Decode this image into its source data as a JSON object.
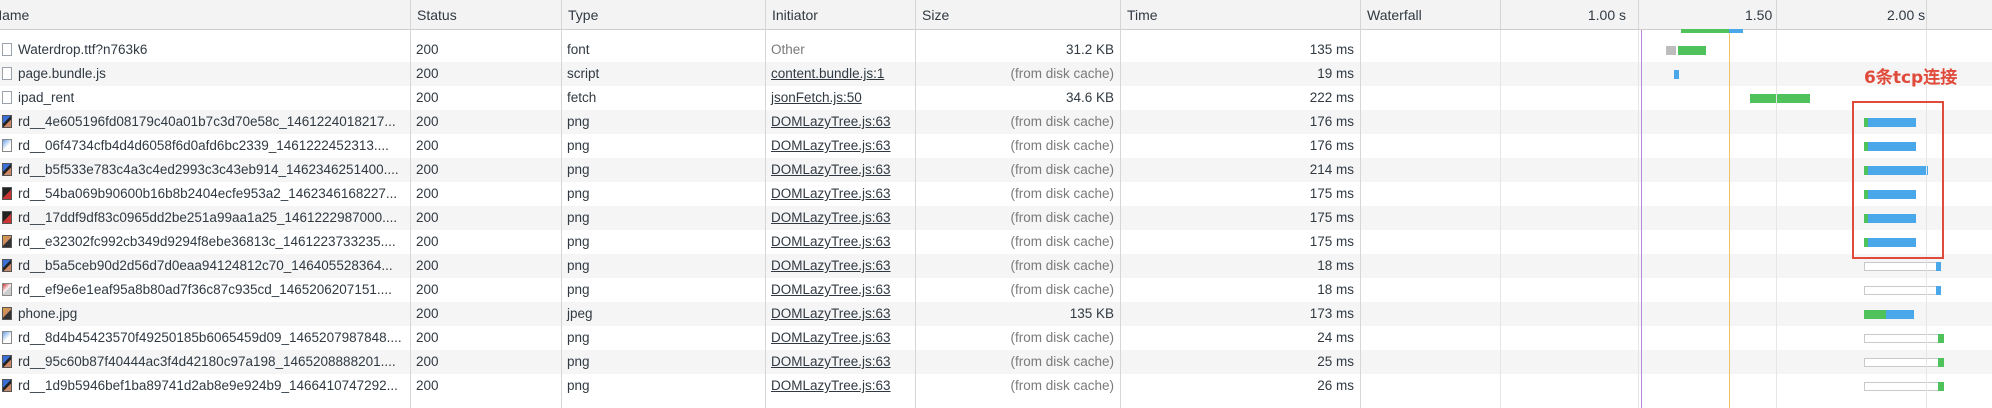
{
  "header": {
    "name": "Name",
    "status": "Status",
    "type": "Type",
    "initiator": "Initiator",
    "size": "Size",
    "time": "Time",
    "waterfall": "Waterfall",
    "ticks": [
      "1.00 s",
      "1.50 s",
      "2.00 s"
    ]
  },
  "rows": [
    {
      "name": "Waterdrop.ttf?n763k6",
      "status": "200",
      "type": "font",
      "initiator": "Other",
      "size": "31.2 KB",
      "time": "135 ms"
    },
    {
      "name": "page.bundle.js",
      "status": "200",
      "type": "script",
      "initiator": "content.bundle.js:1",
      "size": "(from disk cache)",
      "time": "19 ms"
    },
    {
      "name": "ipad_rent",
      "status": "200",
      "type": "fetch",
      "initiator": "jsonFetch.js:50",
      "size": "34.6 KB",
      "time": "222 ms"
    },
    {
      "name": "rd__4e605196fd08179c40a01b7c3d70e58c_1461224018217...",
      "status": "200",
      "type": "png",
      "initiator": "DOMLazyTree.js:63",
      "size": "(from disk cache)",
      "time": "176 ms"
    },
    {
      "name": "rd__06f4734cfb4d4d6058f6d0afd6bc2339_1461222452313....",
      "status": "200",
      "type": "png",
      "initiator": "DOMLazyTree.js:63",
      "size": "(from disk cache)",
      "time": "176 ms"
    },
    {
      "name": "rd__b5f533e783c4a3c4ed2993c3c43eb914_1462346251400....",
      "status": "200",
      "type": "png",
      "initiator": "DOMLazyTree.js:63",
      "size": "(from disk cache)",
      "time": "214 ms"
    },
    {
      "name": "rd__54ba069b90600b16b8b2404ecfe953a2_1462346168227...",
      "status": "200",
      "type": "png",
      "initiator": "DOMLazyTree.js:63",
      "size": "(from disk cache)",
      "time": "175 ms"
    },
    {
      "name": "rd__17ddf9df83c0965dd2be251a99aa1a25_1461222987000....",
      "status": "200",
      "type": "png",
      "initiator": "DOMLazyTree.js:63",
      "size": "(from disk cache)",
      "time": "175 ms"
    },
    {
      "name": "rd__e32302fc992cb349d9294f8ebe36813c_1461223733235....",
      "status": "200",
      "type": "png",
      "initiator": "DOMLazyTree.js:63",
      "size": "(from disk cache)",
      "time": "175 ms"
    },
    {
      "name": "rd__b5a5ceb90d2d56d7d0eaa94124812c70_146405528364...",
      "status": "200",
      "type": "png",
      "initiator": "DOMLazyTree.js:63",
      "size": "(from disk cache)",
      "time": "18 ms"
    },
    {
      "name": "rd__ef9e6e1eaf95a8b80ad7f36c87c935cd_1465206207151....",
      "status": "200",
      "type": "png",
      "initiator": "DOMLazyTree.js:63",
      "size": "(from disk cache)",
      "time": "18 ms"
    },
    {
      "name": "phone.jpg",
      "status": "200",
      "type": "jpeg",
      "initiator": "DOMLazyTree.js:63",
      "size": "135 KB",
      "time": "173 ms"
    },
    {
      "name": "rd__8d4b45423570f49250185b6065459d09_1465207987848....",
      "status": "200",
      "type": "png",
      "initiator": "DOMLazyTree.js:63",
      "size": "(from disk cache)",
      "time": "24 ms"
    },
    {
      "name": "rd__95c60b87f40444ac3f4d42180c97a198_1465208888201....",
      "status": "200",
      "type": "png",
      "initiator": "DOMLazyTree.js:63",
      "size": "(from disk cache)",
      "time": "25 ms"
    },
    {
      "name": "rd__1d9b5946bef1ba89741d2ab8e9e924b9_1466410747292...",
      "status": "200",
      "type": "png",
      "initiator": "DOMLazyTree.js:63",
      "size": "(from disk cache)",
      "time": "26 ms"
    }
  ],
  "annotation": {
    "text": "6条tcp连接",
    "color": "#e04a3a"
  },
  "colors": {
    "waiting": "#4fc25c",
    "download": "#4aa8ea",
    "header_bg": "#f3f3f3",
    "stripe_bg": "#f5f5f5"
  }
}
